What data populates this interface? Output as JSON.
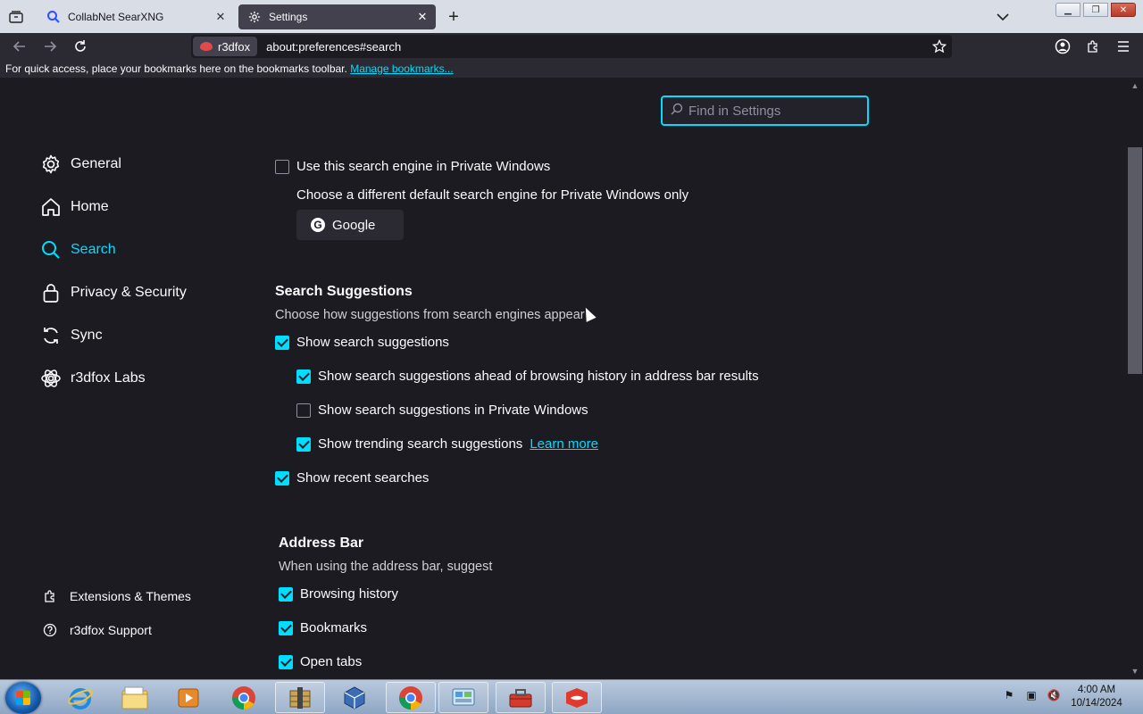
{
  "tabs": [
    {
      "title": "CollabNet SearXNG",
      "favicon": "search-icon"
    },
    {
      "title": "Settings",
      "favicon": "gear-icon",
      "active": true
    }
  ],
  "navbar": {
    "identity_label": "r3dfox",
    "url": "about:preferences#search"
  },
  "bookmarks_bar": {
    "hint": "For quick access, place your bookmarks here on the bookmarks toolbar.",
    "manage_link": "Manage bookmarks..."
  },
  "settings": {
    "find_placeholder": "Find in Settings",
    "categories": [
      {
        "label": "General",
        "icon": "gear-icon"
      },
      {
        "label": "Home",
        "icon": "home-icon"
      },
      {
        "label": "Search",
        "icon": "search-icon",
        "selected": true
      },
      {
        "label": "Privacy & Security",
        "icon": "lock-icon"
      },
      {
        "label": "Sync",
        "icon": "sync-icon"
      },
      {
        "label": "r3dfox Labs",
        "icon": "labs-icon"
      }
    ],
    "footer_links": [
      {
        "label": "Extensions & Themes",
        "icon": "puzzle-icon"
      },
      {
        "label": "r3dfox Support",
        "icon": "help-icon"
      }
    ],
    "private_engine": {
      "checkbox_label": "Use this search engine in Private Windows",
      "checked": false,
      "description": "Choose a different default search engine for Private Windows only",
      "engine": "Google"
    },
    "search_suggestions": {
      "heading": "Search Suggestions",
      "description": "Choose how suggestions from search engines appear",
      "show_suggestions": {
        "label": "Show search suggestions",
        "checked": true
      },
      "ahead_of_history": {
        "label": "Show search suggestions ahead of browsing history in address bar results",
        "checked": true
      },
      "private_windows": {
        "label": "Show search suggestions in Private Windows",
        "checked": false
      },
      "trending": {
        "label": "Show trending search suggestions",
        "checked": true,
        "link": "Learn more"
      },
      "recent": {
        "label": "Show recent searches",
        "checked": true
      }
    },
    "address_bar": {
      "heading": "Address Bar",
      "description": "When using the address bar, suggest",
      "browsing_history": {
        "label": "Browsing history",
        "checked": true
      },
      "bookmarks": {
        "label": "Bookmarks",
        "checked": true
      },
      "open_tabs": {
        "label": "Open tabs",
        "checked": true
      }
    }
  },
  "taskbar": {
    "clock_time": "4:00 AM",
    "clock_date": "10/14/2024",
    "apps": [
      "internet-explorer-icon",
      "file-explorer-icon",
      "media-player-icon",
      "chrome-icon",
      "archive-icon",
      "virtualbox-icon",
      "chrome-icon",
      "control-panel-icon",
      "toolbox-icon",
      "r3dfox-icon"
    ]
  }
}
